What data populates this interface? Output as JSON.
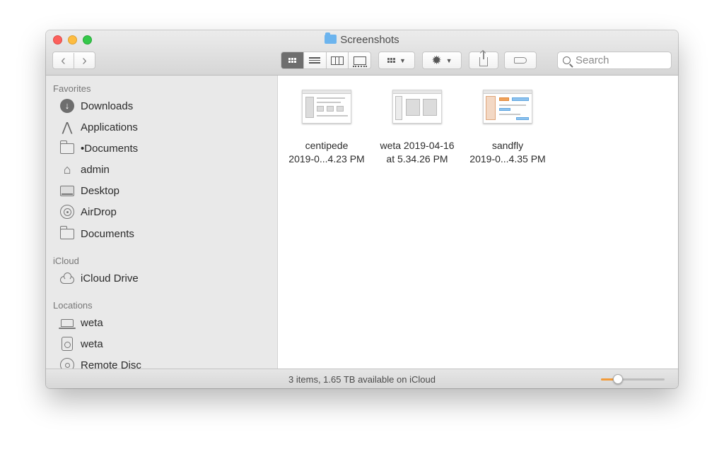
{
  "window": {
    "title": "Screenshots"
  },
  "toolbar": {
    "back_label": "‹",
    "forward_label": "›",
    "search_placeholder": "Search"
  },
  "sidebar": {
    "sections": [
      {
        "title": "Favorites",
        "items": [
          {
            "label": "Downloads",
            "icon": "download-icon"
          },
          {
            "label": "Applications",
            "icon": "applications-icon"
          },
          {
            "label": "•Documents",
            "icon": "folder-icon"
          },
          {
            "label": "admin",
            "icon": "home-icon"
          },
          {
            "label": "Desktop",
            "icon": "desktop-icon"
          },
          {
            "label": "AirDrop",
            "icon": "airdrop-icon"
          },
          {
            "label": "Documents",
            "icon": "folder-icon"
          }
        ]
      },
      {
        "title": "iCloud",
        "items": [
          {
            "label": "iCloud Drive",
            "icon": "cloud-icon"
          }
        ]
      },
      {
        "title": "Locations",
        "items": [
          {
            "label": "weta",
            "icon": "laptop-icon"
          },
          {
            "label": "weta",
            "icon": "drive-icon"
          },
          {
            "label": "Remote Disc",
            "icon": "disc-icon"
          }
        ]
      }
    ]
  },
  "files": [
    {
      "name_line1": "centipede",
      "name_line2": "2019-0...4.23 PM"
    },
    {
      "name_line1": "weta 2019-04-16",
      "name_line2": "at 5.34.26 PM"
    },
    {
      "name_line1": "sandfly",
      "name_line2": "2019-0...4.35 PM"
    }
  ],
  "status": {
    "text": "3 items, 1.65 TB available on iCloud",
    "icon_size_fraction": 0.27
  },
  "colors": {
    "close": "#fc605c",
    "minimize": "#fdbc40",
    "maximize": "#34c84a",
    "slider_fill": "#f29b3a"
  }
}
